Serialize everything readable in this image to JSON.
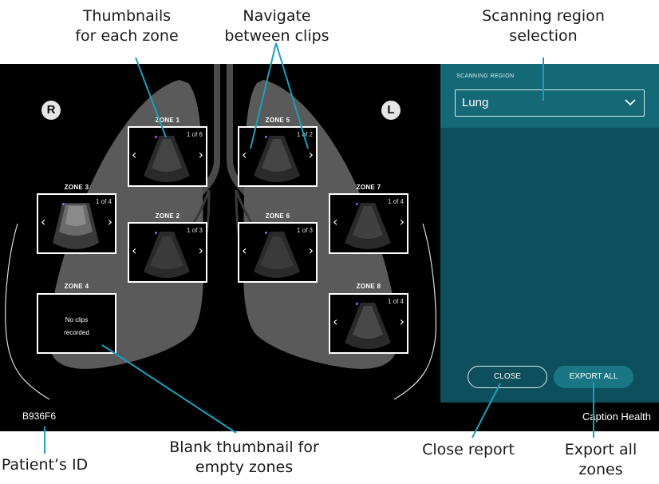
{
  "annotations": {
    "thumbnails": [
      "Thumbnails",
      "for each zone"
    ],
    "navigate": [
      "Navigate",
      "between clips"
    ],
    "scanning_region": [
      "Scanning region",
      "selection"
    ],
    "patient_id": [
      "Patient’s ID"
    ],
    "blank_thumbnail": [
      "Blank thumbnail for",
      "empty zones"
    ],
    "close_report": [
      "Close report"
    ],
    "export_all": [
      "Export all",
      "zones"
    ]
  },
  "side_labels": {
    "right": "R",
    "left": "L"
  },
  "zones": [
    {
      "id": "zone1",
      "label": "ZONE 1",
      "count": "1 of 6",
      "empty": false
    },
    {
      "id": "zone2",
      "label": "ZONE 2",
      "count": "1 of 3",
      "empty": false
    },
    {
      "id": "zone3",
      "label": "ZONE 3",
      "count": "1 of 4",
      "empty": false
    },
    {
      "id": "zone4",
      "label": "ZONE 4",
      "count": "",
      "empty": true,
      "empty_text": "No clips recorded"
    },
    {
      "id": "zone5",
      "label": "ZONE 5",
      "count": "1 of 2",
      "empty": false
    },
    {
      "id": "zone6",
      "label": "ZONE 6",
      "count": "1 of 3",
      "empty": false
    },
    {
      "id": "zone7",
      "label": "ZONE 7",
      "count": "1 of 4",
      "empty": false
    },
    {
      "id": "zone8",
      "label": "ZONE 8",
      "count": "1 of 4",
      "empty": false
    }
  ],
  "nav_icons": {
    "prev": "chevron-left-icon",
    "next": "chevron-right-icon"
  },
  "panel": {
    "region_heading": "SCANNING REGION",
    "region_value": "Lung",
    "close_label": "CLOSE",
    "export_label": "EXPORT ALL"
  },
  "footer": {
    "patient_id": "B936F6",
    "brand": "Caption Health"
  },
  "colors": {
    "callout": "#1aa0be",
    "panel": "#0d4f5c",
    "panel_top": "#156876",
    "export_button": "#1a7585",
    "lung_silhouette": "#5a5a5a"
  }
}
